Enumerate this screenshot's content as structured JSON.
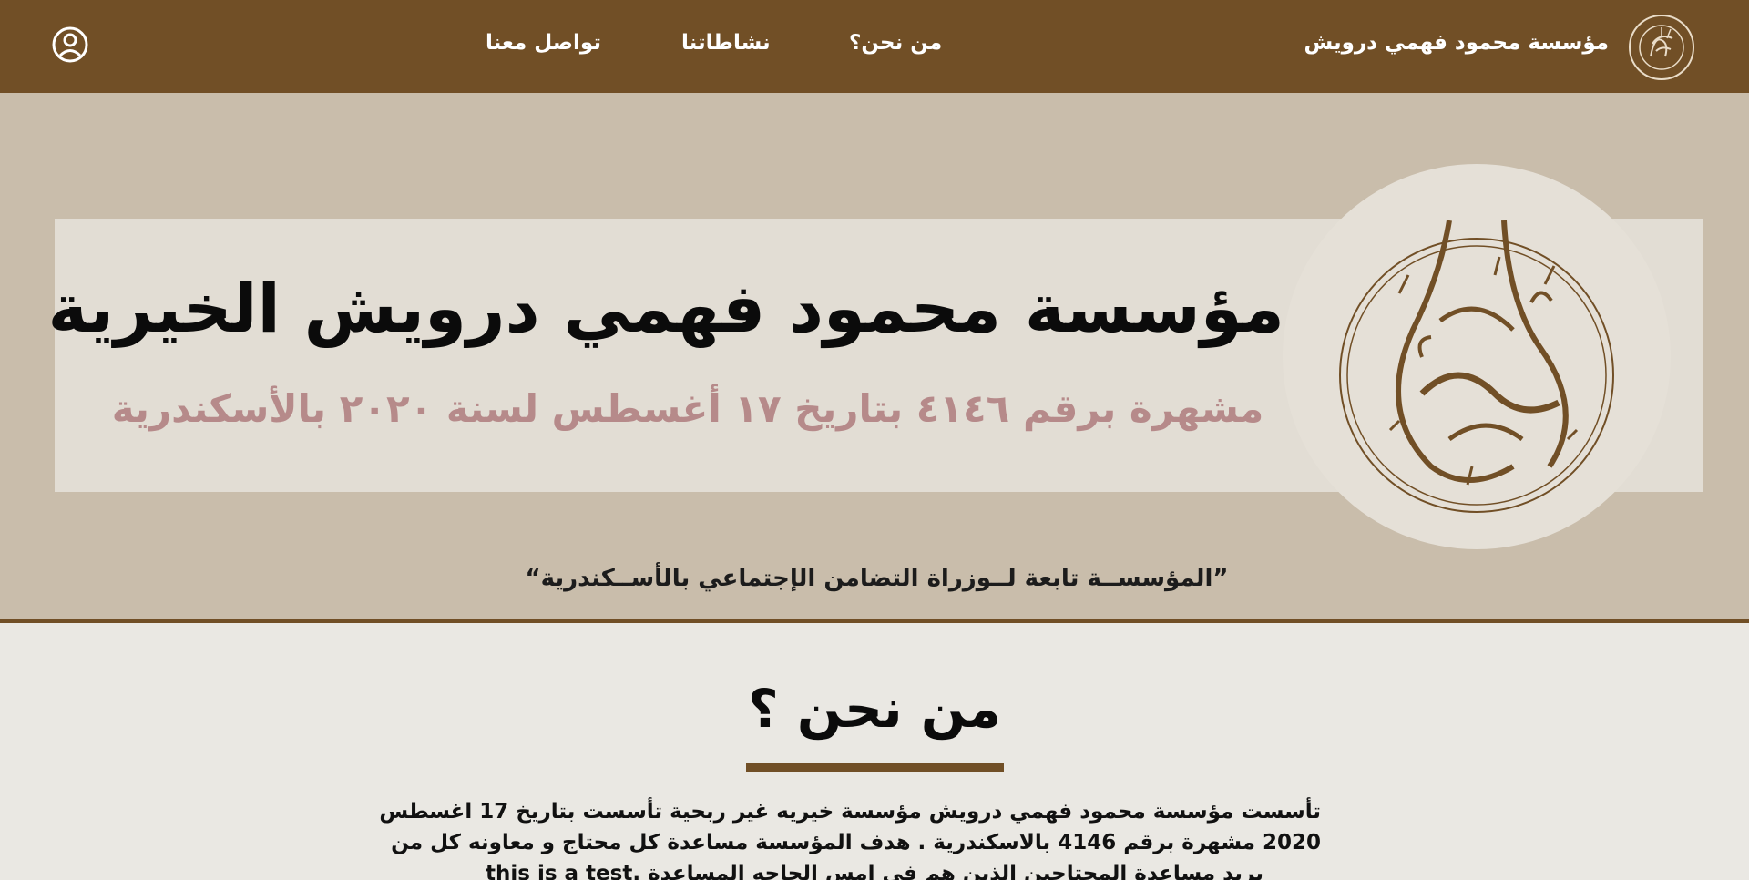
{
  "header": {
    "brand_name": "مؤسسة محمود فهمي درويش",
    "logo_icon": "calligraphy-logo-icon",
    "nav": [
      {
        "label": "من نحن؟"
      },
      {
        "label": "نشاطاتنا"
      },
      {
        "label": "تواصل معنا"
      }
    ],
    "user_icon": "user-circle-icon",
    "background_color": "#714f26"
  },
  "hero": {
    "title": "مؤسسة محمود فهمي درويش الخيرية",
    "subtitle": "مشهرة برقم ٤١٤٦ بتاريخ ١٧ أغسطس لسنة ٢٠٢٠ بالأسكندرية",
    "quote": "”المؤسســة تابعة لــوزراة التضامن الإجتماعي بالأســكندرية“",
    "emblem_icon": "calligraphy-emblem-icon",
    "background_color": "#c9bdab",
    "subtitle_color": "#b68a8a"
  },
  "about": {
    "title": "من نحن ؟",
    "body_lines": [
      "تأسست مؤسسة محمود فهمي درويش مؤسسة خيريه غير ربحية تأسست بتاريخ 17 اغسطس",
      "2020 مشهرة برقم 4146 بالاسكندرية . هدف المؤسسة مساعدة كل محتاج و معاونه كل من",
      "يريد مساعدة المحتاجين الذين هم فى امس الحاجه المساعدة  .this is a test"
    ],
    "accent_color": "#714f26"
  }
}
